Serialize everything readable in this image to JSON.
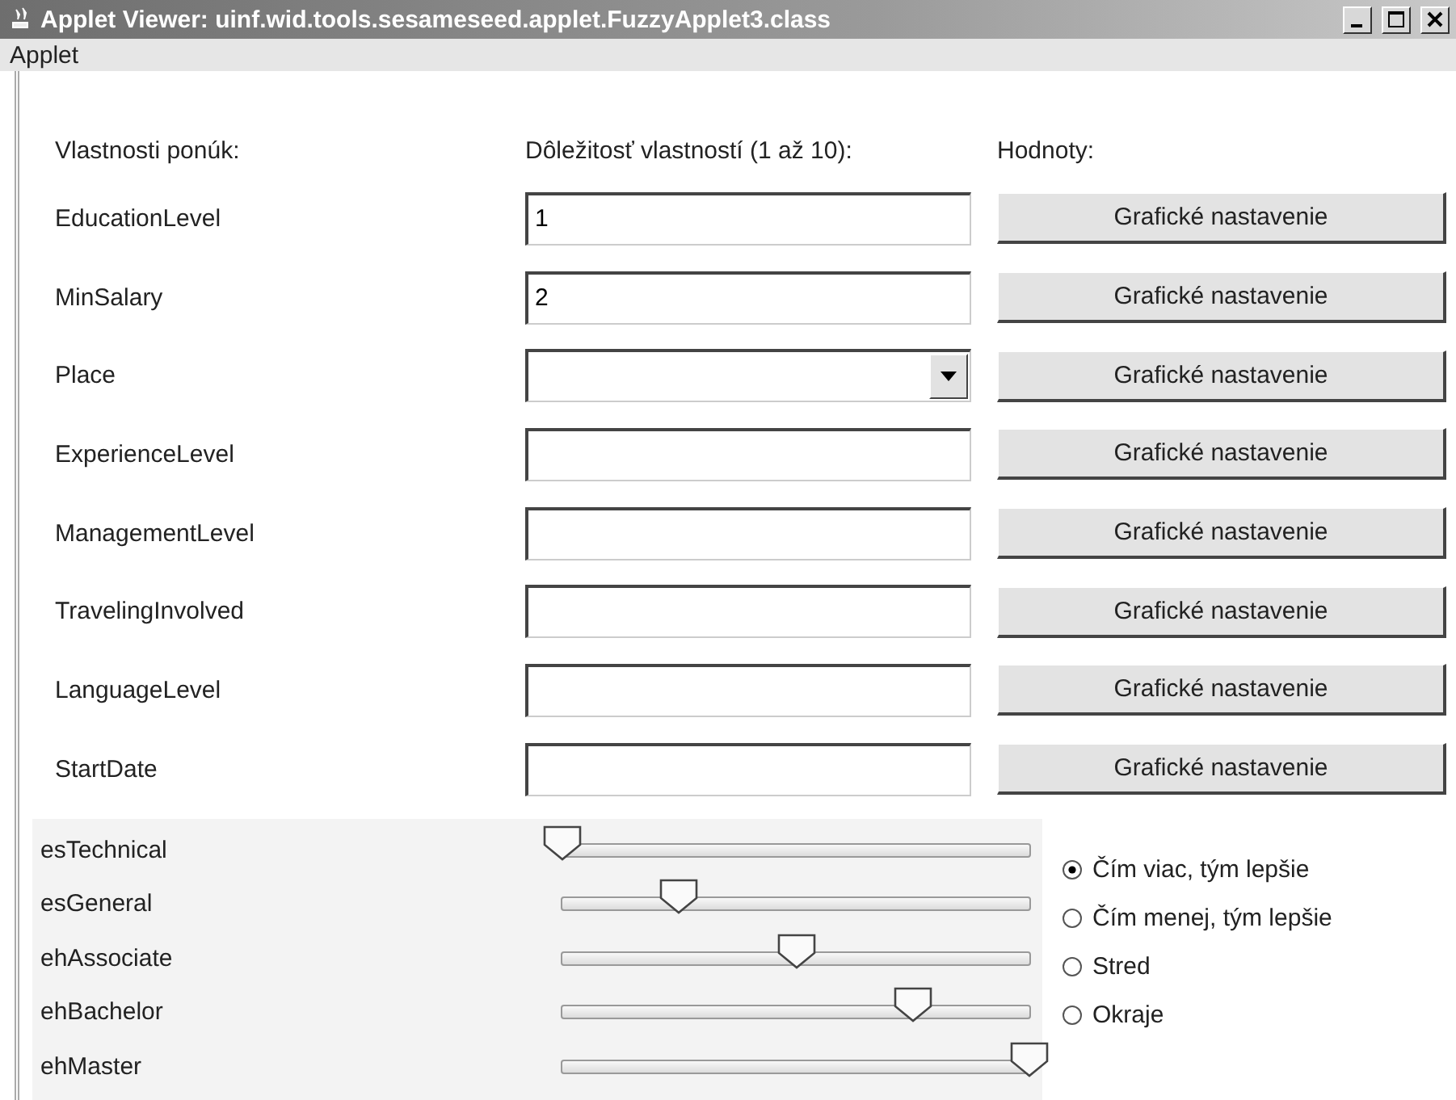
{
  "window": {
    "title": "Applet Viewer: uinf.wid.tools.sesameseed.applet.FuzzyApplet3.class"
  },
  "menu": [
    "Applet"
  ],
  "headers": [
    "Vlastnosti ponúk:",
    "Dôležitosť vlastností (1 až 10):",
    "Hodnoty:"
  ],
  "properties": [
    {
      "name": "EducationLevel",
      "kind": "text",
      "value": "1",
      "button": "Grafické nastavenie"
    },
    {
      "name": "MinSalary",
      "kind": "text",
      "value": "2",
      "button": "Grafické nastavenie"
    },
    {
      "name": "Place",
      "kind": "combo",
      "button": "Grafické nastavenie"
    },
    {
      "name": "ExperienceLevel",
      "kind": "text",
      "button": "Grafické nastavenie"
    },
    {
      "name": "ManagementLevel",
      "kind": "text",
      "button": "Grafické nastavenie"
    },
    {
      "name": "TravelingInvolved",
      "kind": "text",
      "button": "Grafické nastavenie"
    },
    {
      "name": "LanguageLevel",
      "kind": "text",
      "button": "Grafické nastavenie"
    },
    {
      "name": "StartDate",
      "kind": "text",
      "button": "Grafické nastavenie"
    }
  ],
  "sliders": [
    {
      "name": "esTechnical",
      "level": 0
    },
    {
      "name": "esGeneral",
      "level": 0.25
    },
    {
      "name": "ehAssociate",
      "level": 0.5
    },
    {
      "name": "ehBachelor",
      "level": 0.75
    },
    {
      "name": "ehMaster",
      "level": 1
    }
  ],
  "options": [
    {
      "label": "Čím viac, tým lepšie",
      "selected": true
    },
    {
      "label": "Čím menej, tým lepšie",
      "selected": false
    },
    {
      "label": "Stred",
      "selected": false
    },
    {
      "label": "Okraje",
      "selected": false
    }
  ]
}
